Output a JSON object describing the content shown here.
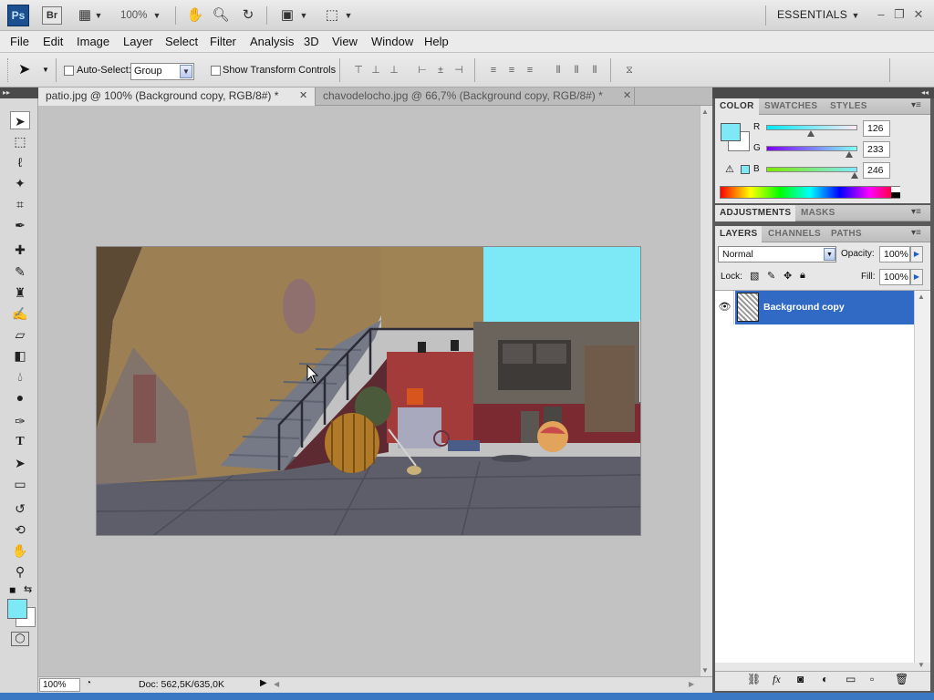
{
  "appbar": {
    "ps_logo": "Ps",
    "br_logo": "Br",
    "zoom": "100%",
    "workspace": "ESSENTIALS",
    "minimize_icon": "–",
    "restore_icon": "❐",
    "close_icon": "✕"
  },
  "menu": [
    "File",
    "Edit",
    "Image",
    "Layer",
    "Select",
    "Filter",
    "Analysis",
    "3D",
    "View",
    "Window",
    "Help"
  ],
  "options": {
    "auto_select_label": "Auto-Select:",
    "auto_select_value": "Group",
    "show_transform_label": "Show Transform Controls"
  },
  "tabs": [
    {
      "label": "patio.jpg @ 100% (Background copy, RGB/8#) *",
      "close": "✕"
    },
    {
      "label": "chavodelocho.jpg @ 66,7% (Background copy, RGB/8#) *",
      "close": "✕"
    }
  ],
  "status": {
    "zoom": "100%",
    "doc": "Doc: 562,5K/635,0K"
  },
  "color_panel": {
    "tabs": [
      "COLOR",
      "SWATCHES",
      "STYLES"
    ],
    "r_label": "R",
    "g_label": "G",
    "b_label": "B",
    "r": "126",
    "g": "233",
    "b": "246",
    "r_level": 0.494,
    "g_level": 0.914,
    "b_level": 0.965,
    "foreground": "#7ee9f6",
    "background": "#ffffff"
  },
  "adjustments_panel": {
    "tabs": [
      "ADJUSTMENTS",
      "MASKS"
    ]
  },
  "layers_panel": {
    "tabs": [
      "LAYERS",
      "CHANNELS",
      "PATHS"
    ],
    "blend_mode": "Normal",
    "opacity_label": "Opacity:",
    "opacity": "100%",
    "lock_label": "Lock:",
    "fill_label": "Fill:",
    "fill": "100%",
    "layer_name": "Background copy"
  },
  "colors": {
    "selection": "#316ac5",
    "foreground": "#7ee9f6"
  }
}
